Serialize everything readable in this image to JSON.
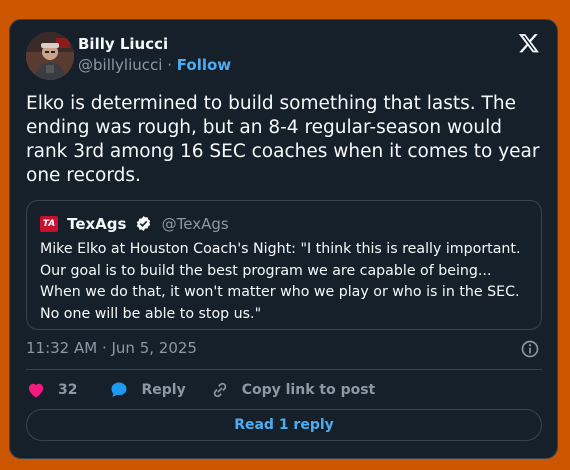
{
  "author": {
    "name": "Billy Liucci",
    "handle": "@billyliucci",
    "separator": "·",
    "follow_label": "Follow"
  },
  "post": {
    "text": "Elko is determined to build something that lasts. The ending was rough, but an 8-4 regular-season would rank 3rd among 16 SEC coaches when it comes to year one records.",
    "timestamp": "11:32 AM · Jun 5, 2025"
  },
  "quote": {
    "logo_text": "TA",
    "name": "TexAgs",
    "handle": "@TexAgs",
    "text": "Mike Elko at Houston Coach's Night: \"I think this is really important. Our goal is to build the best program we are capable of being... When we do that, it won't matter who we play or who is in the SEC. No one will be able to stop us.\""
  },
  "actions": {
    "like_count": "32",
    "reply_label": "Reply",
    "copy_label": "Copy link to post",
    "read_replies_label": "Read 1 reply"
  },
  "icons": {
    "logo": "x-logo-icon",
    "verified": "verified-badge-icon",
    "info": "info-icon",
    "like": "heart-icon",
    "reply": "speech-bubble-icon",
    "copy": "link-icon"
  },
  "colors": {
    "page_background": "#cc5500",
    "card_background": "#15202b",
    "border": "#38444d",
    "text_primary": "#f7f9f9",
    "text_secondary": "#8b98a5",
    "accent": "#4eadf2",
    "like": "#f91880",
    "reply": "#1d9bf0",
    "texags_red": "#c8102e"
  }
}
